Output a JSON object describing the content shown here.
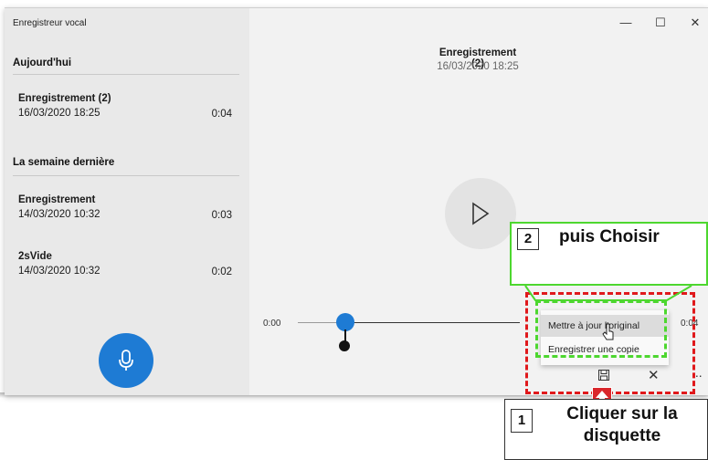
{
  "app": {
    "title": "Enregistreur vocal"
  },
  "window_controls": {
    "minimize": "—",
    "maximize": "☐",
    "close": "✕"
  },
  "sidebar": {
    "sections": [
      {
        "heading": "Aujourd'hui",
        "items": [
          {
            "name": "Enregistrement (2)",
            "date": "16/03/2020 18:25",
            "duration": "0:04"
          }
        ]
      },
      {
        "heading": "La semaine dernière",
        "items": [
          {
            "name": "Enregistrement",
            "date": "14/03/2020 10:32",
            "duration": "0:03"
          },
          {
            "name": "2sVide",
            "date": "14/03/2020 10:32",
            "duration": "0:02"
          }
        ]
      }
    ],
    "record_button_icon": "microphone-icon"
  },
  "player": {
    "title": "Enregistrement (2)",
    "date": "16/03/2020 18:25",
    "time_start": "0:00",
    "time_end": "0:04",
    "position_fraction": 0.1,
    "play_icon": "play-icon"
  },
  "save_menu": {
    "items": [
      "Mettre à jour l'original",
      "Enregistrer une copie"
    ]
  },
  "toolbar": {
    "save_icon": "floppy-disk-icon",
    "close_icon": "close-icon",
    "more_label": "..."
  },
  "annotations": {
    "step1": {
      "number": "1",
      "text": "Cliquer sur la disquette"
    },
    "step2": {
      "number": "2",
      "text": "puis Choisir"
    }
  },
  "colors": {
    "accent": "#1e7bd4",
    "annotation_red": "#e0191c",
    "annotation_green": "#4dd72f"
  }
}
